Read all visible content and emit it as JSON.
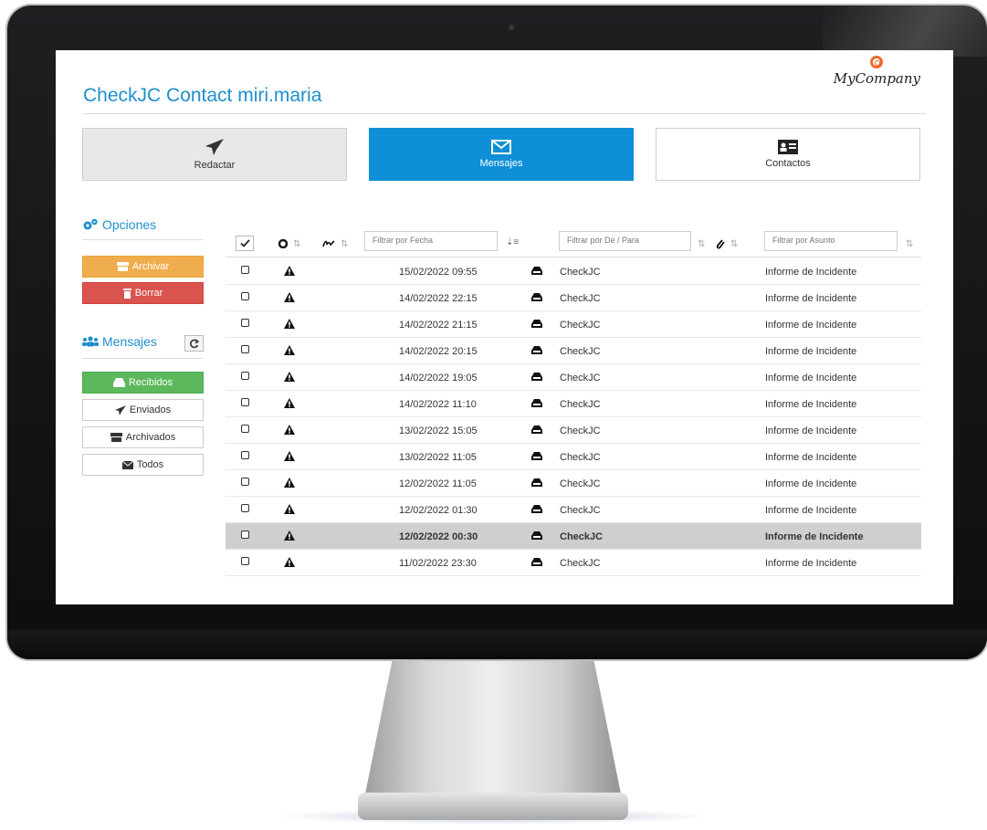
{
  "app": {
    "title": "CheckJC Contact miri.maria",
    "logo_text": "MyCompany"
  },
  "nav": {
    "redactar": "Redactar",
    "mensajes": "Mensajes",
    "contactos": "Contactos"
  },
  "sidebar": {
    "opciones_title": "Opciones",
    "archivar": "Archivar",
    "borrar": "Borrar",
    "mensajes_title": "Mensajes",
    "recibidos": "Recibidos",
    "enviados": "Enviados",
    "archivados": "Archivados",
    "todos": "Todos"
  },
  "filters": {
    "fecha": "Filtrar por Fecha",
    "de_para": "Filtrar por De / Para",
    "asunto": "Filtrar por Asunto"
  },
  "rows": [
    {
      "date": "15/02/2022 09:55",
      "from": "CheckJC",
      "subject": "Informe de Incidente"
    },
    {
      "date": "14/02/2022 22:15",
      "from": "CheckJC",
      "subject": "Informe de Incidente"
    },
    {
      "date": "14/02/2022 21:15",
      "from": "CheckJC",
      "subject": "Informe de Incidente"
    },
    {
      "date": "14/02/2022 20:15",
      "from": "CheckJC",
      "subject": "Informe de Incidente"
    },
    {
      "date": "14/02/2022 19:05",
      "from": "CheckJC",
      "subject": "Informe de Incidente"
    },
    {
      "date": "14/02/2022 11:10",
      "from": "CheckJC",
      "subject": "Informe de Incidente"
    },
    {
      "date": "13/02/2022 15:05",
      "from": "CheckJC",
      "subject": "Informe de Incidente"
    },
    {
      "date": "13/02/2022 11:05",
      "from": "CheckJC",
      "subject": "Informe de Incidente"
    },
    {
      "date": "12/02/2022 11:05",
      "from": "CheckJC",
      "subject": "Informe de Incidente"
    },
    {
      "date": "12/02/2022 01:30",
      "from": "CheckJC",
      "subject": "Informe de Incidente"
    },
    {
      "date": "12/02/2022 00:30",
      "from": "CheckJC",
      "subject": "Informe de Incidente",
      "selected": true
    },
    {
      "date": "11/02/2022 23:30",
      "from": "CheckJC",
      "subject": "Informe de Incidente"
    }
  ],
  "colors": {
    "accent": "#1f8fce",
    "primary_button": "#0e8fd6",
    "archive": "#f0ad4e",
    "delete": "#d9534f",
    "received": "#5cb85c",
    "selected_row": "#cfcfcf"
  }
}
